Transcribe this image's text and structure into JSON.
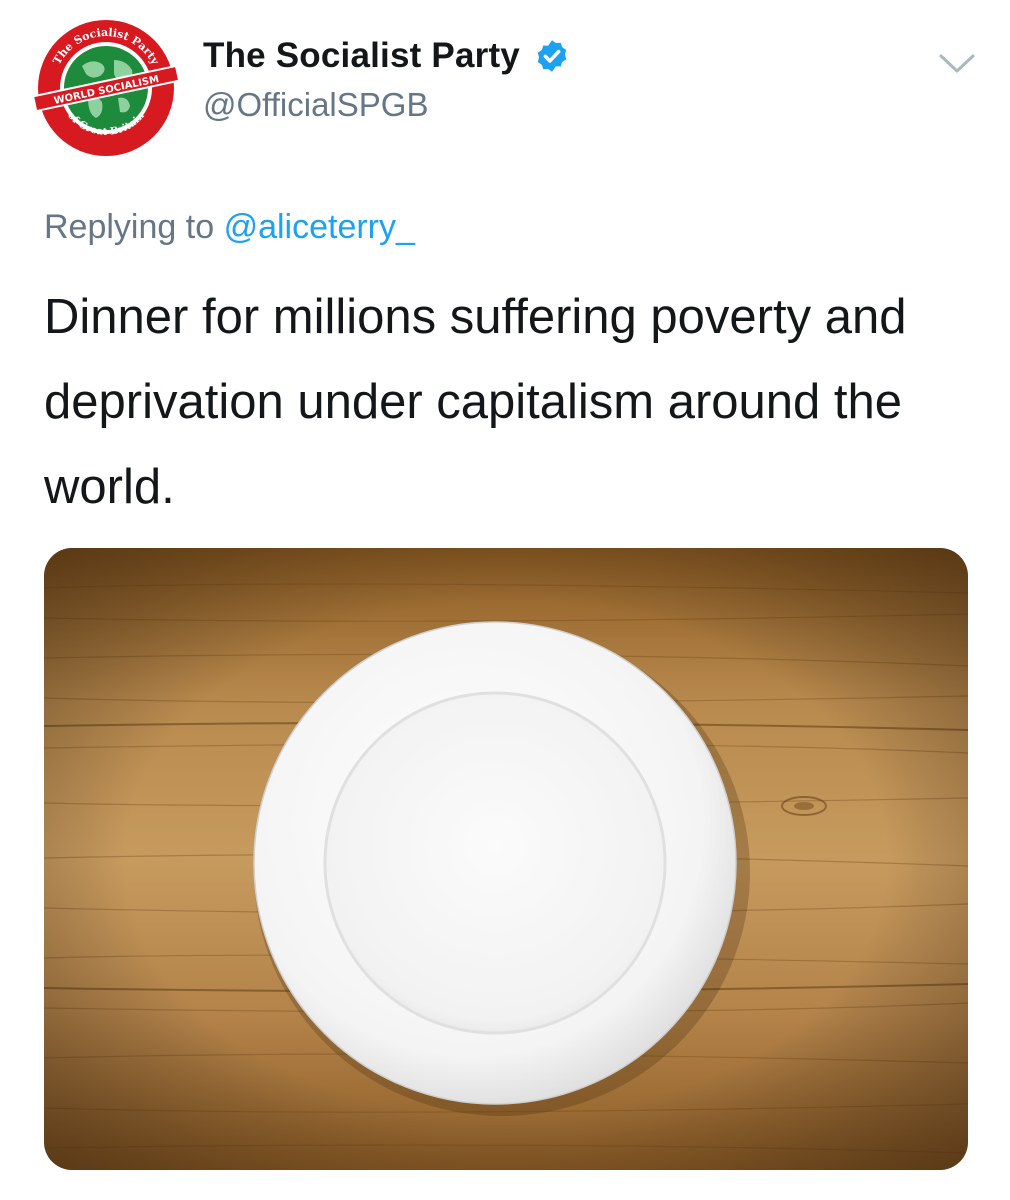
{
  "author": {
    "display_name": "The Socialist Party",
    "handle": "@OfficialSPGB",
    "verified": true,
    "avatar": {
      "top_arc_text": "The Socialist Party",
      "band_text": "WORLD SOCIALISM",
      "bottom_arc_text": "of Great Britain"
    }
  },
  "reply": {
    "prefix": "Replying to",
    "user": "@aliceterry_"
  },
  "tweet": {
    "text": "Dinner for millions suffering poverty and deprivation under capitalism around the world."
  },
  "media": {
    "image_icon": "empty-plate-on-wooden-table"
  },
  "colors": {
    "verified_blue": "#1da1f2",
    "link_blue": "#1da1f2",
    "secondary_text": "#657786",
    "primary_text": "#14171a",
    "logo_red": "#d71920",
    "logo_green": "#1e8a3c"
  },
  "icons": {
    "menu": "chevron-down-icon",
    "verified": "verified-badge-icon"
  }
}
